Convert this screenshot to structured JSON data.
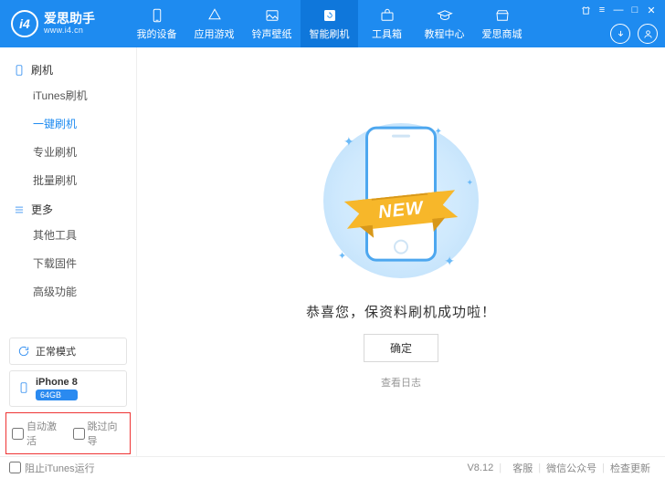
{
  "app": {
    "name": "爱思助手",
    "url": "www.i4.cn"
  },
  "nav": [
    {
      "label": "我的设备"
    },
    {
      "label": "应用游戏"
    },
    {
      "label": "铃声壁纸"
    },
    {
      "label": "智能刷机",
      "active": true
    },
    {
      "label": "工具箱"
    },
    {
      "label": "教程中心"
    },
    {
      "label": "爱思商城"
    }
  ],
  "sidebar": {
    "group1": "刷机",
    "items1": [
      {
        "label": "iTunes刷机"
      },
      {
        "label": "一键刷机",
        "active": true
      },
      {
        "label": "专业刷机"
      },
      {
        "label": "批量刷机"
      }
    ],
    "group2": "更多",
    "items2": [
      {
        "label": "其他工具"
      },
      {
        "label": "下载固件"
      },
      {
        "label": "高级功能"
      }
    ],
    "mode": "正常模式",
    "device": {
      "name": "iPhone 8",
      "storage": "64GB"
    },
    "checks": {
      "autoActivate": "自动激活",
      "skipGuide": "跳过向导"
    }
  },
  "content": {
    "ribbon": "NEW",
    "message": "恭喜您，保资料刷机成功啦！",
    "okButton": "确定",
    "logLink": "查看日志"
  },
  "status": {
    "blockItunes": "阻止iTunes运行",
    "version": "V8.12",
    "links": [
      "客服",
      "微信公众号",
      "检查更新"
    ]
  }
}
